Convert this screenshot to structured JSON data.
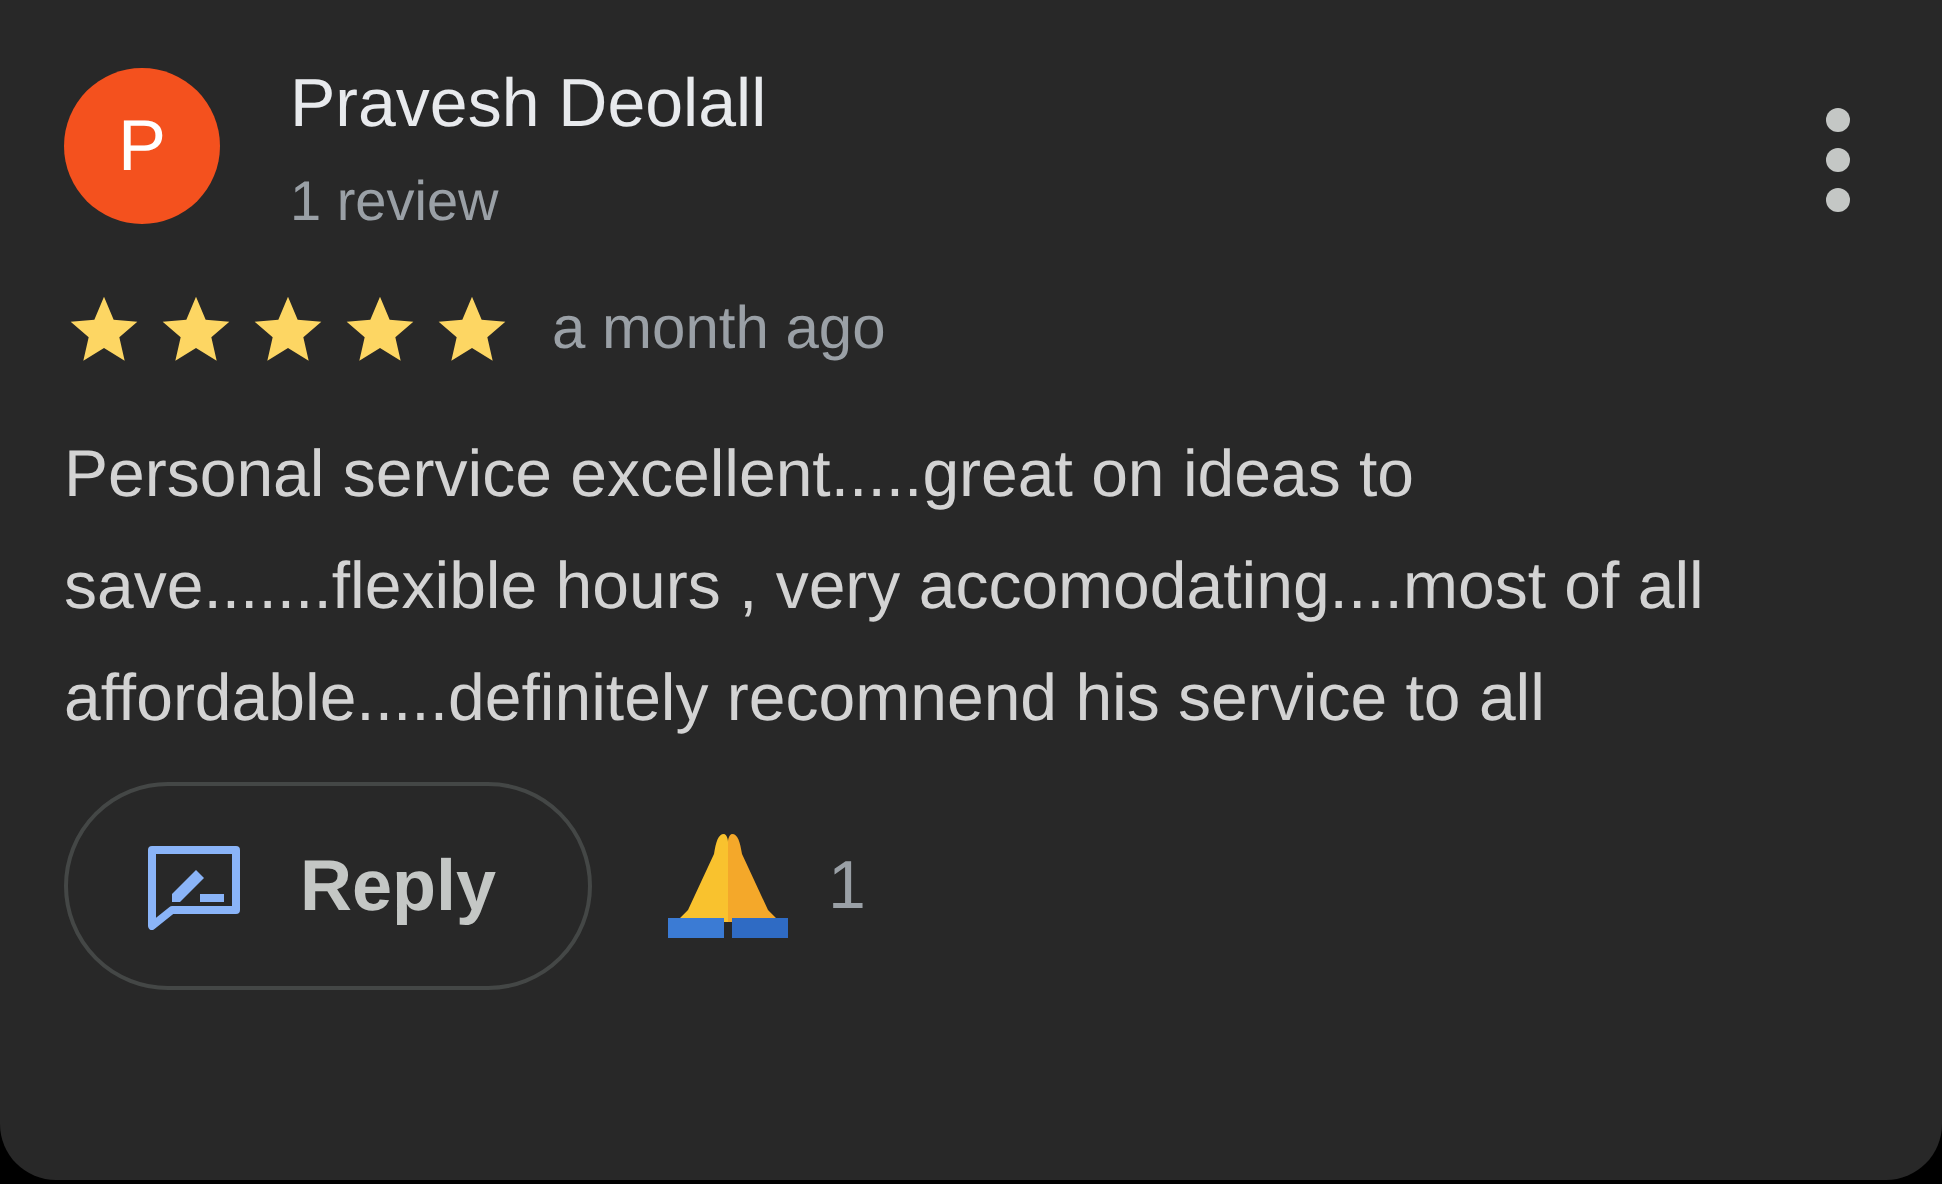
{
  "review": {
    "avatar_letter": "P",
    "author": "Pravesh Deolall",
    "author_meta": "1 review",
    "stars": 5,
    "time": "a month ago",
    "text": "Personal service excellent.....great on ideas to save.......flexible hours , very accomodating....most of all affordable.....definitely recomnend his service to all",
    "reply_button": "Reply",
    "reaction_count": "1"
  }
}
